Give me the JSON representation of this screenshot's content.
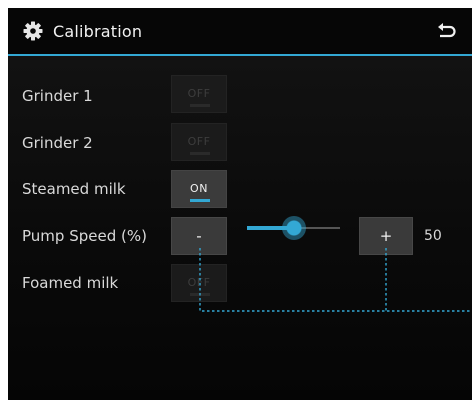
{
  "header": {
    "title": "Calibration",
    "settings_icon": "gear-icon",
    "back_icon": "back-arrow-icon",
    "accent_color": "#33a8d4"
  },
  "rows": [
    {
      "label": "Grinder 1",
      "toggle": "OFF",
      "state": "disabled"
    },
    {
      "label": "Grinder 2",
      "toggle": "OFF",
      "state": "disabled"
    },
    {
      "label": "Steamed milk",
      "toggle": "ON",
      "state": "on"
    },
    {
      "label": "Pump Speed (%)"
    },
    {
      "label": "Foamed milk",
      "toggle": "OFF",
      "state": "disabled"
    }
  ],
  "pump_speed": {
    "decrease_label": "-",
    "increase_label": "+",
    "value": "50",
    "slider_level_percent": 50
  }
}
